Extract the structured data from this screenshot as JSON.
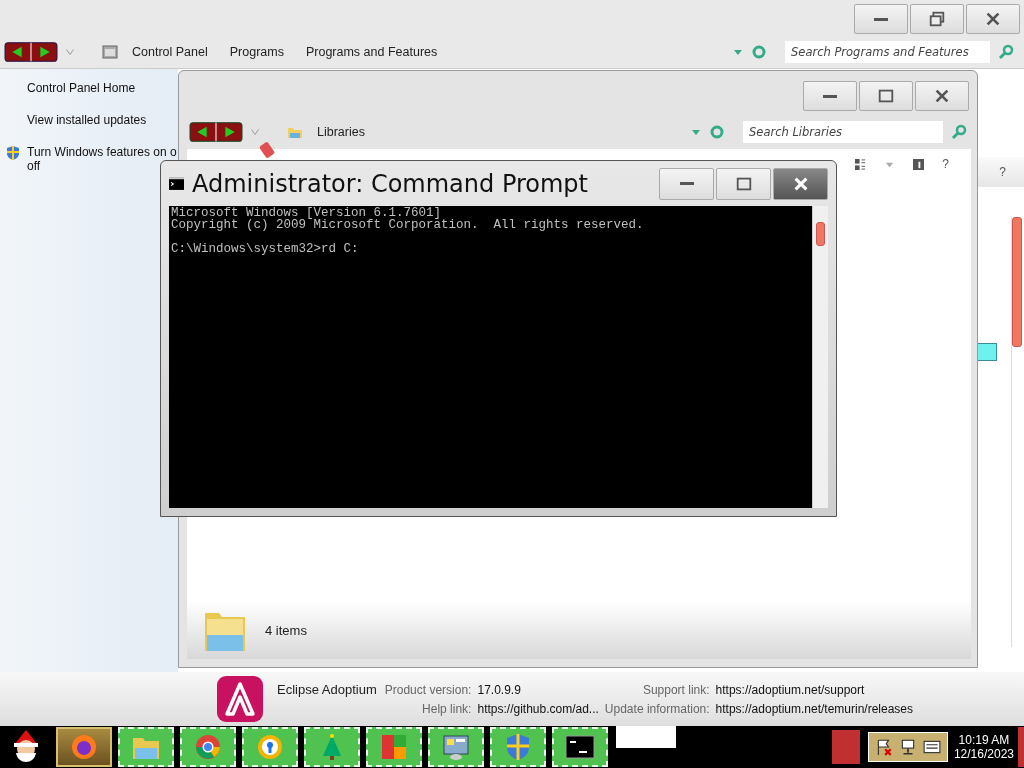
{
  "control_panel": {
    "breadcrumb": [
      "Control Panel",
      "Programs",
      "Programs and Features"
    ],
    "search": {
      "placeholder": "Search Programs and Features"
    },
    "sidebar": [
      {
        "label": "Control Panel Home",
        "kind": "link"
      },
      {
        "label": "View installed updates",
        "kind": "link"
      },
      {
        "label": "Turn Windows features on o\noff",
        "kind": "shield"
      }
    ],
    "help": "?",
    "details": {
      "app_name": "Eclipse Adoptium",
      "fields": [
        {
          "label": "Product version:",
          "value": "17.0.9.9"
        },
        {
          "label": "Support link:",
          "value": "https://adoptium.net/support"
        },
        {
          "label": "Help link:",
          "value": "https://github.com/ad..."
        },
        {
          "label": "Update information:",
          "value": "https://adoptium.net/temurin/releases"
        }
      ]
    }
  },
  "libraries": {
    "address": "Libraries",
    "search": {
      "placeholder": "Search Libraries"
    },
    "help": "?",
    "status": "4 items"
  },
  "cmd": {
    "title": "Administrator: Command Prompt",
    "paragraphs": [
      [
        "Microsoft Windows [Version 6.1.7601]",
        "Copyright (c) 2009 Microsoft Corporation.  All rights reserved."
      ],
      [
        "C:\\Windows\\system32>rd C:"
      ]
    ]
  },
  "taskbar": {
    "tasks": [
      {
        "kind": "firefox",
        "selected": true
      },
      {
        "kind": "folder",
        "selected": false
      },
      {
        "kind": "chrome",
        "selected": false
      },
      {
        "kind": "browser",
        "selected": false
      },
      {
        "kind": "tree",
        "selected": false
      },
      {
        "kind": "app",
        "selected": false
      },
      {
        "kind": "panel",
        "selected": false
      },
      {
        "kind": "shield",
        "selected": false
      },
      {
        "kind": "console",
        "selected": false
      }
    ],
    "time": "10:19 AM",
    "date": "12/16/2023"
  }
}
